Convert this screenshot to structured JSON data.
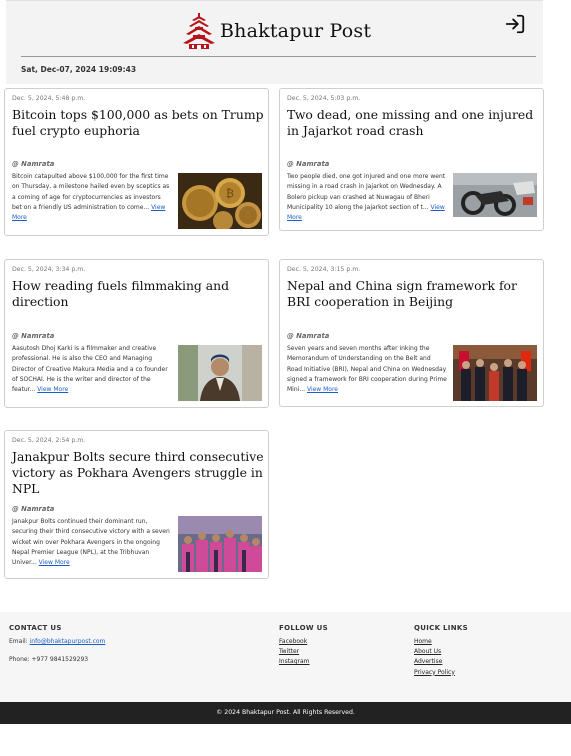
{
  "site": {
    "name": "Bhaktapur Post",
    "datetime": "Sat, Dec-07, 2024 19:09:43"
  },
  "articles": [
    {
      "date": "Dec. 5, 2024, 5:48 p.m.",
      "title": "Bitcoin tops $100,000 as bets on Trump fuel crypto euphoria",
      "author": "@ Namrata",
      "excerpt": "Bitcoin catapulted above $100,000 for the first time on Thursday, a milestone hailed even by sceptics as a coming of age for cryptocurrencies as investors bet on a friendly US administration to come...",
      "more": "View More",
      "image_icon": "bitcoin-coins-photo"
    },
    {
      "date": "Dec. 5, 2024, 5:03 p.m.",
      "title": "Two dead, one missing and one injured in Jajarkot road crash",
      "author": "@ Namrata",
      "excerpt": "Two people died, one got injured and one more went missing in a road crash in Jajarkot on Wednesday. A Bolero pickup van crashed at Nuwagau of Bheri Municipality 10 along the Jajarkot section of t...",
      "more": "View More",
      "image_icon": "crashed-motorcycle-photo"
    },
    {
      "date": "Dec. 5, 2024, 3:34 p.m.",
      "title": "How reading fuels filmmaking and direction",
      "author": "@ Namrata",
      "excerpt": "Aasutosh Dhoj Karki is a filmmaker and creative professional. He is also the CEO and Managing Director of Creative Makura Media and a co founder of SOCHAI. He is the writer and director of the featur...",
      "more": "View More",
      "image_icon": "portrait-photo"
    },
    {
      "date": "Dec. 5, 2024, 3:15 p.m.",
      "title": "Nepal and China sign framework for BRI cooperation in Beijing",
      "author": "@ Namrata",
      "excerpt": "Seven years and seven months after inking the Memorandum of Understanding on the Belt and Road Initiative (BRI), Nepal and China on Wednesday signed a framework for BRI cooperation during Prime Mini...",
      "more": "View More",
      "image_icon": "signing-ceremony-photo"
    },
    {
      "date": "Dec. 5, 2024, 2:54 p.m.",
      "title": "Janakpur Bolts secure third consecutive victory as Pokhara Avengers struggle in NPL",
      "author": "@ Namrata",
      "excerpt": "Janakpur Bolts continued their dominant run, securing their third consecutive victory with a seven wicket win over Pokhara Avengers in the ongoing Nepal Premier League (NPL), at the Tribhuvan Univer...",
      "more": "View More",
      "image_icon": "cricket-team-photo"
    }
  ],
  "footer": {
    "contact": {
      "heading": "CONTACT US",
      "email_label": "Email:",
      "email": "info@bhaktapurpost.com",
      "phone": "Phone: +977 9841529293"
    },
    "follow": {
      "heading": "FOLLOW US",
      "links": [
        "Facebook",
        "Twitter",
        "Instagram"
      ]
    },
    "quick": {
      "heading": "QUICK LINKS",
      "links": [
        "Home",
        "About Us",
        "Advertise",
        "Privacy Policy"
      ]
    },
    "copyright": "© 2024 Bhaktapur Post. All Rights Reserved."
  },
  "colors": {
    "link": "#1a5fc8",
    "logo": "#b8141c",
    "footer_bar": "#222222"
  }
}
